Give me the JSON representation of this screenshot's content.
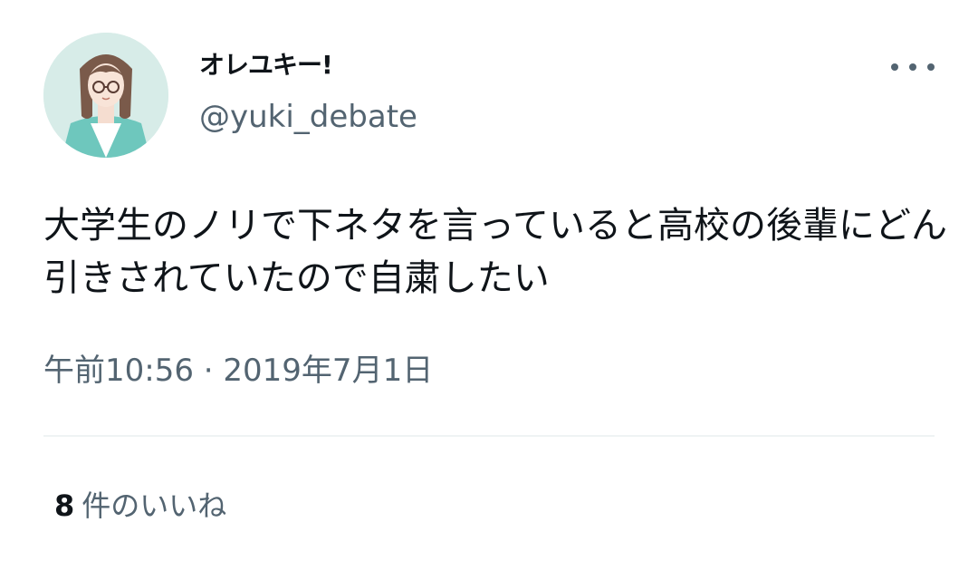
{
  "author": {
    "display_name": "オレユキー!",
    "handle": "@yuki_debate"
  },
  "tweet": {
    "text": "大学生のノリで下ネタを言っていると高校の後輩にどん引きされていたので自粛したい",
    "timestamp": "午前10:56 · 2019年7月1日"
  },
  "stats": {
    "likes_count": "8",
    "likes_label": "件のいいね"
  },
  "icons": {
    "more": "more-horizontal-icon"
  },
  "colors": {
    "text_primary": "#0f1419",
    "text_secondary": "#536471",
    "divider": "#eff3f4",
    "avatar_bg": "#d7ece8"
  }
}
